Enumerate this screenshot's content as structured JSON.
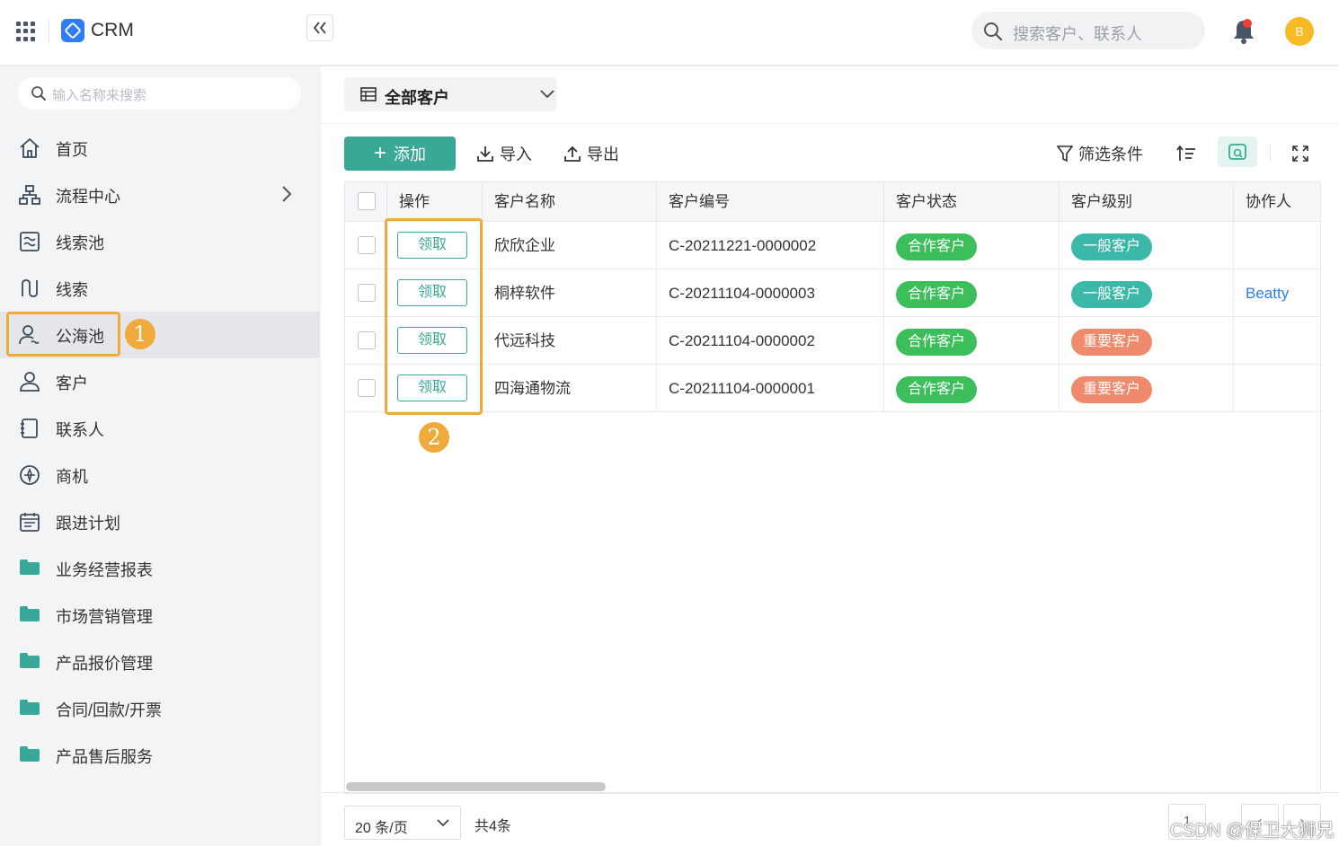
{
  "app": {
    "title": "CRM",
    "avatar_initial": "B"
  },
  "top_search": {
    "placeholder": "搜索客户、联系人"
  },
  "sidebar": {
    "search_placeholder": "输入名称来搜索",
    "items": [
      {
        "label": "首页",
        "icon": "home-icon"
      },
      {
        "label": "流程中心",
        "icon": "flow-icon",
        "has_children": true
      },
      {
        "label": "线索池",
        "icon": "lead-pool-icon"
      },
      {
        "label": "线索",
        "icon": "lead-icon"
      },
      {
        "label": "公海池",
        "icon": "public-pool-icon",
        "active": true
      },
      {
        "label": "客户",
        "icon": "customer-icon"
      },
      {
        "label": "联系人",
        "icon": "contact-icon"
      },
      {
        "label": "商机",
        "icon": "opportunity-icon"
      },
      {
        "label": "跟进计划",
        "icon": "plan-icon"
      },
      {
        "label": "业务经营报表",
        "icon": "folder-icon"
      },
      {
        "label": "市场营销管理",
        "icon": "folder-icon"
      },
      {
        "label": "产品报价管理",
        "icon": "folder-icon"
      },
      {
        "label": "合同/回款/开票",
        "icon": "folder-icon"
      },
      {
        "label": "产品售后服务",
        "icon": "folder-icon"
      }
    ]
  },
  "annotations": {
    "marker_1": "1",
    "marker_2": "2",
    "color": "#f0a93b"
  },
  "main": {
    "view_selector": "全部客户",
    "toolbar": {
      "add": "添加",
      "import": "导入",
      "export": "导出",
      "filter": "筛选条件"
    },
    "table": {
      "columns": [
        "操作",
        "客户名称",
        "客户编号",
        "客户状态",
        "客户级别",
        "协作人"
      ],
      "rows": [
        {
          "action": "领取",
          "name": "欣欣企业",
          "code": "C-20211221-0000002",
          "status": "合作客户",
          "level": "一般客户",
          "collaborator": ""
        },
        {
          "action": "领取",
          "name": "桐梓软件",
          "code": "C-20211104-0000003",
          "status": "合作客户",
          "level": "一般客户",
          "collaborator": "Beatty"
        },
        {
          "action": "领取",
          "name": "代远科技",
          "code": "C-20211104-0000002",
          "status": "合作客户",
          "level": "重要客户",
          "collaborator": ""
        },
        {
          "action": "领取",
          "name": "四海通物流",
          "code": "C-20211104-0000001",
          "status": "合作客户",
          "level": "重要客户",
          "collaborator": ""
        }
      ]
    },
    "pagination": {
      "page_size": "20 条/页",
      "total": "共4条",
      "current_page": "1"
    }
  },
  "colors": {
    "primary": "#3aa896",
    "status_cooperating": "#3cbf5a",
    "level_normal": "#3cb8a8",
    "level_important": "#f08a6c",
    "link": "#2f7cf6"
  },
  "watermark": "CSDN @保卫大狮兄"
}
